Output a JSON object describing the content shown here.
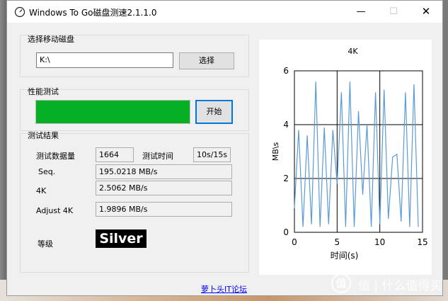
{
  "window": {
    "title": "Windows To Go磁盘测速2.1.1.0",
    "controls": {
      "minimize": "—",
      "maximize": "☐",
      "close": "✕"
    }
  },
  "disk_select": {
    "group_label": "选择移动磁盘",
    "path_value": "K:\\",
    "select_button": "选择"
  },
  "performance": {
    "group_label": "性能测试",
    "progress_fraction": 1.0,
    "start_button": "开始"
  },
  "results": {
    "group_label": "测试结果",
    "data_size_label": "测试数据量",
    "data_size_value": "1664",
    "test_time_label": "测试时间",
    "test_time_value": "10s/15s",
    "seq_label": "Seq.",
    "seq_value": "195.0218 MB/s",
    "k4_label": "4K",
    "k4_value": "2.5062 MB/s",
    "adjust_label": "Adjust 4K",
    "adjust_value": "1.9896 MB/s",
    "grade_label": "等级",
    "grade_value": "Silver"
  },
  "footer": {
    "link_text": "萝卜头IT论坛"
  },
  "watermark": {
    "text": "值 | 什么值得买",
    "icon": "值"
  },
  "colors": {
    "progress_green": "#06b025",
    "series_line": "#5b9bd5",
    "link": "#0000ff",
    "focus_border": "#0078d7"
  },
  "chart_data": {
    "type": "line",
    "title": "4K",
    "xlabel": "时间(s)",
    "ylabel": "MB\\s",
    "xlim": [
      0,
      15
    ],
    "ylim": [
      0,
      6
    ],
    "xticks": [
      0,
      5,
      10,
      15
    ],
    "yticks": [
      0,
      2,
      4,
      6
    ],
    "grid": true,
    "legend": "none",
    "series": [
      {
        "x": [
          0,
          0.5,
          1.0,
          1.5,
          2.0,
          2.5,
          3.0,
          3.5,
          4.0,
          4.5,
          5.0,
          5.5,
          6.0,
          6.5,
          7.0,
          7.5,
          8.0,
          8.5,
          9.0,
          9.5,
          10.0,
          10.5,
          11.0,
          11.5,
          12.0,
          12.5,
          13.0,
          13.5,
          14.0,
          14.5
        ],
        "y": [
          0.9,
          3.8,
          0.2,
          3.6,
          0.3,
          5.6,
          0.2,
          3.9,
          0.3,
          3.8,
          1.8,
          5.2,
          0.2,
          5.6,
          0.2,
          4.5,
          1.4,
          4.0,
          0.2,
          5.2,
          0.3,
          5.3,
          0.5,
          2.8,
          2.9,
          0.4,
          5.2,
          0.2,
          5.5,
          0.2
        ]
      }
    ]
  }
}
